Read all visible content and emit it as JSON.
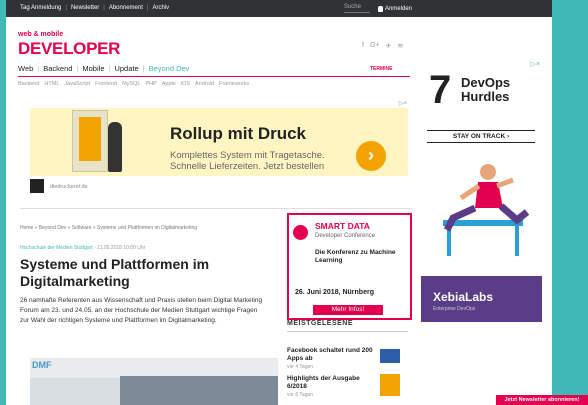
{
  "topbar": {
    "links": [
      "Tag Anmeldung",
      "Newsletter",
      "Abonnement",
      "Archiv"
    ],
    "search": "Suche",
    "login": "Anmelden"
  },
  "header": {
    "logo_small": "web & mobile",
    "logo_big": "DEVELOPER",
    "termine": "TERMINE"
  },
  "nav": [
    "Web",
    "Backend",
    "Mobile",
    "Update",
    "Beyond Dev"
  ],
  "subnav": [
    "Backend",
    "HTML",
    "JavaScript",
    "Frontend",
    "MySQL",
    "PHP",
    "Apple",
    "iOS",
    "Android",
    "Frameworks"
  ],
  "ad_top": {
    "adchoice": "▷×",
    "headline": "Rollup mit Druck",
    "desc": "Komplettes System mit Tragetasche. Schnelle Lieferzeiten. Jetzt bestellen",
    "go": "›",
    "brand_url": "diedruckerei.de"
  },
  "article": {
    "breadcrumb": "Home » Beyond Dev » Software » Systeme und Plattformen im Digitalmarketing",
    "source": "Hochschule der Medien Stuttgart",
    "date": "11.05.2018 10:00 Uhr",
    "title": "Systeme und Plattformen im Digitalmarketing",
    "lead": "26 namhafte Referenten aus Wissenschaft und Praxis stellen beim Digital Marketing Forum am 23. und 24.05. an der Hochschule der Medien Stuttgart wichtige Fragen zur Wahl der richtigen Systeme und Plattformen im Digitalmarketing.",
    "image_label": "DMF"
  },
  "ad_side": {
    "title": "SMART DATA",
    "subtitle": "Developer Conference",
    "claim": "Die Konferenz zu Machine Learning",
    "date": "26. Juni 2018, Nürnberg",
    "cta": "Mehr Infos!"
  },
  "meistgelesen": {
    "heading": "MEISTGELESENE",
    "items": [
      {
        "title": "Facebook schaltet rund 200 Apps ab",
        "sub": "vor 4 Tagen"
      },
      {
        "title": "Highlights der Ausgabe 6/2018",
        "sub": "vor 6 Tagen"
      }
    ]
  },
  "sky_ad": {
    "adchoice": "▷×",
    "number": "7",
    "title": "DevOps Hurdles",
    "stay": "STAY ON TRACK ›",
    "brand": "XebiaLabs",
    "brand_sub": "Enterprise DevOps"
  },
  "newsletter_button": "Jetzt Newsletter abonnieren!",
  "colors": {
    "brand": "#e3004f",
    "accent": "#3fb8b6"
  }
}
